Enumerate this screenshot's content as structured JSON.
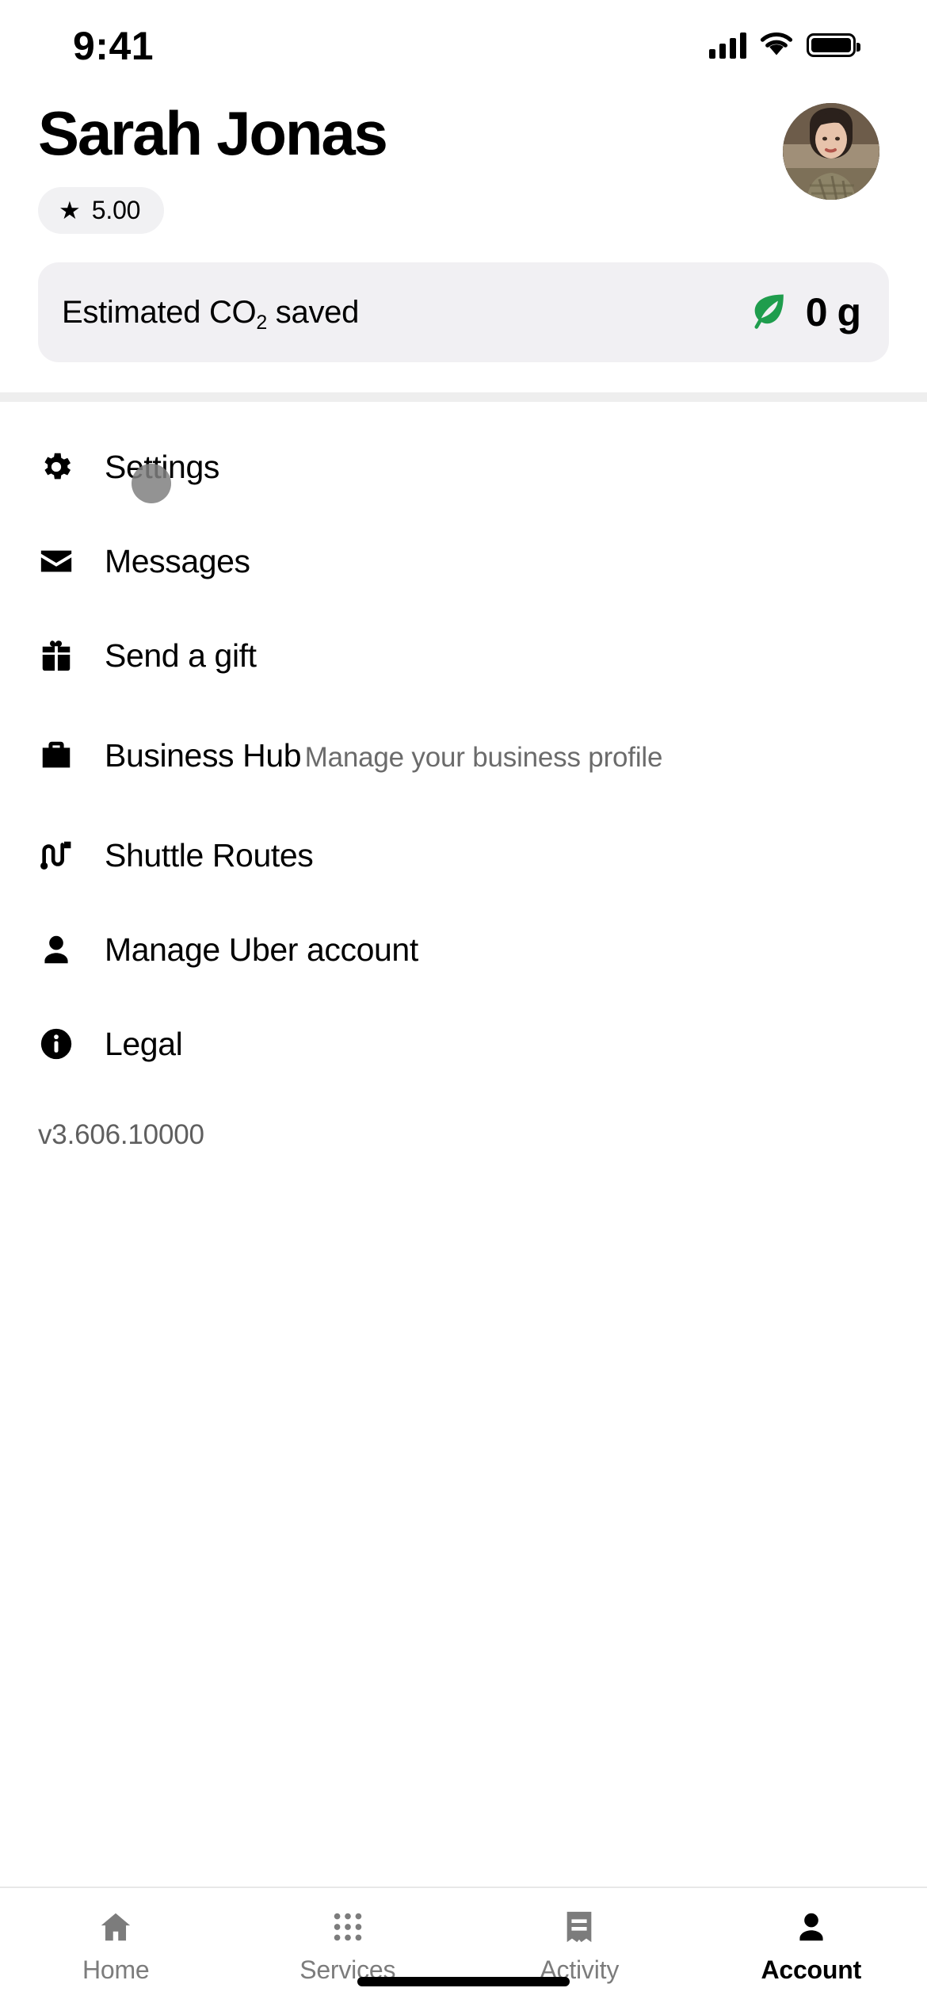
{
  "status_bar": {
    "time": "9:41",
    "cellular_icon": "signal-bars-icon",
    "wifi_icon": "wifi-icon",
    "battery_icon": "battery-full-icon"
  },
  "header": {
    "name": "Sarah Jonas",
    "rating": "5.00",
    "rating_star_icon": "star-icon",
    "avatar_icon": "user-avatar-photo"
  },
  "co2_card": {
    "label_prefix": "Estimated CO",
    "label_sub": "2",
    "label_suffix": " saved",
    "leaf_icon": "leaf-icon",
    "leaf_color": "#1f9d4d",
    "value": "0 g"
  },
  "menu": {
    "items": [
      {
        "label": "Settings",
        "icon": "gear-icon",
        "subtitle": ""
      },
      {
        "label": "Messages",
        "icon": "envelope-icon",
        "subtitle": ""
      },
      {
        "label": "Send a gift",
        "icon": "gift-icon",
        "subtitle": ""
      },
      {
        "label": "Business Hub",
        "icon": "briefcase-icon",
        "subtitle": "Manage your business profile"
      },
      {
        "label": "Shuttle Routes",
        "icon": "route-icon",
        "subtitle": ""
      },
      {
        "label": "Manage Uber account",
        "icon": "person-icon",
        "subtitle": ""
      },
      {
        "label": "Legal",
        "icon": "info-circle-icon",
        "subtitle": ""
      }
    ]
  },
  "version": "v3.606.10000",
  "tabbar": {
    "tabs": [
      {
        "label": "Home",
        "icon": "home-icon",
        "active": false
      },
      {
        "label": "Services",
        "icon": "grid-dots-icon",
        "active": false
      },
      {
        "label": "Activity",
        "icon": "receipt-icon",
        "active": false
      },
      {
        "label": "Account",
        "icon": "person-icon",
        "active": true
      }
    ]
  },
  "colors": {
    "accent_green": "#1f9d4d",
    "card_bg": "#f1f0f3",
    "pill_bg": "#f1f1f3",
    "muted_text": "#6b6b6b",
    "divider": "#eeeeee"
  }
}
